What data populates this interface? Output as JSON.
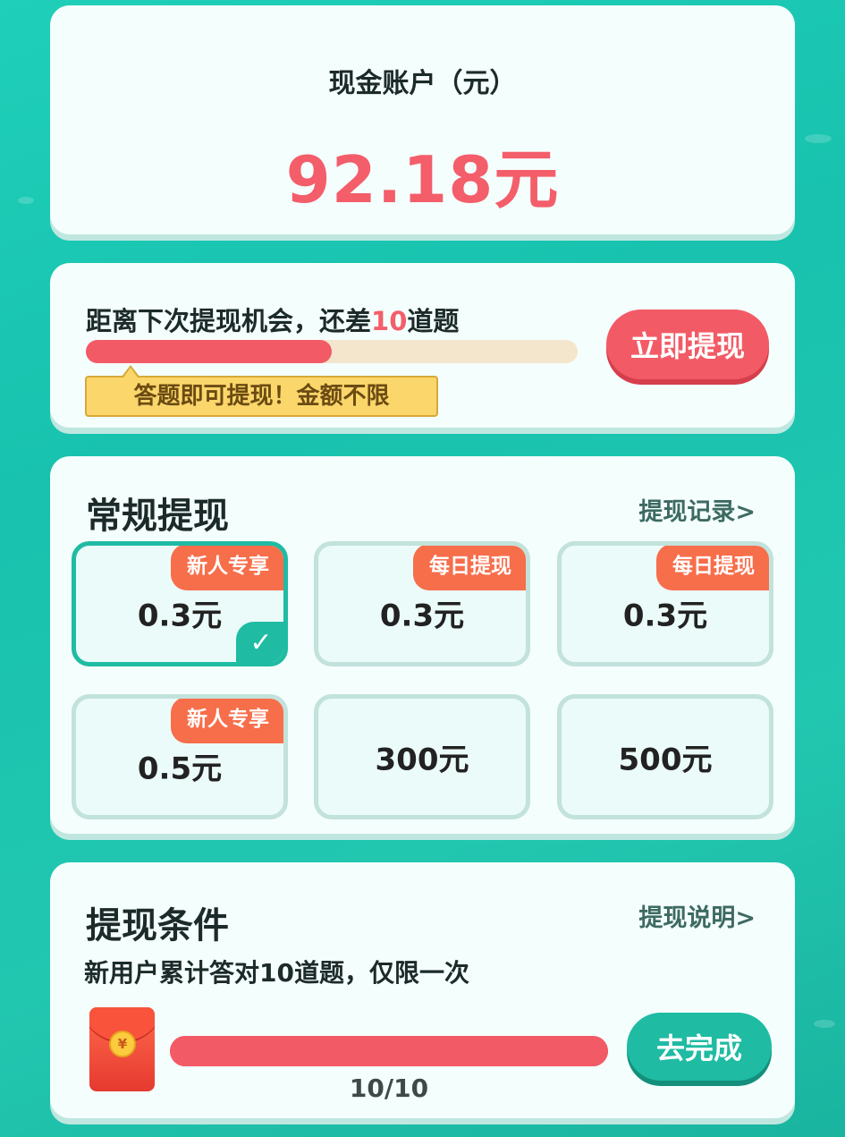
{
  "account": {
    "title": "现金账户（元）",
    "amount": "92.18元"
  },
  "chance": {
    "text_prefix": "距离下次提现机会，还差",
    "remaining": "10",
    "text_suffix": "道题",
    "progress": 0.5,
    "tip": "答题即可提现！金额不限",
    "button": "立即提现"
  },
  "regular": {
    "title": "常规提现",
    "record_link": "提现记录>",
    "options": [
      {
        "value": "0.3元",
        "badge": "新人专享",
        "selected": true
      },
      {
        "value": "0.3元",
        "badge": "每日提现",
        "selected": false
      },
      {
        "value": "0.3元",
        "badge": "每日提现",
        "selected": false
      },
      {
        "value": "0.5元",
        "badge": "新人专享",
        "selected": false
      },
      {
        "value": "300元",
        "badge": "",
        "selected": false
      },
      {
        "value": "500元",
        "badge": "",
        "selected": false
      }
    ]
  },
  "condition": {
    "title": "提现条件",
    "explain_link": "提现说明>",
    "description": "新用户累计答对10道题，仅限一次",
    "progress": 1,
    "count": "10/10",
    "button": "去完成",
    "coin_symbol": "¥"
  },
  "colors": {
    "accent_red": "#f25b66",
    "accent_teal": "#1fbba3",
    "badge_orange": "#f76e4b"
  }
}
